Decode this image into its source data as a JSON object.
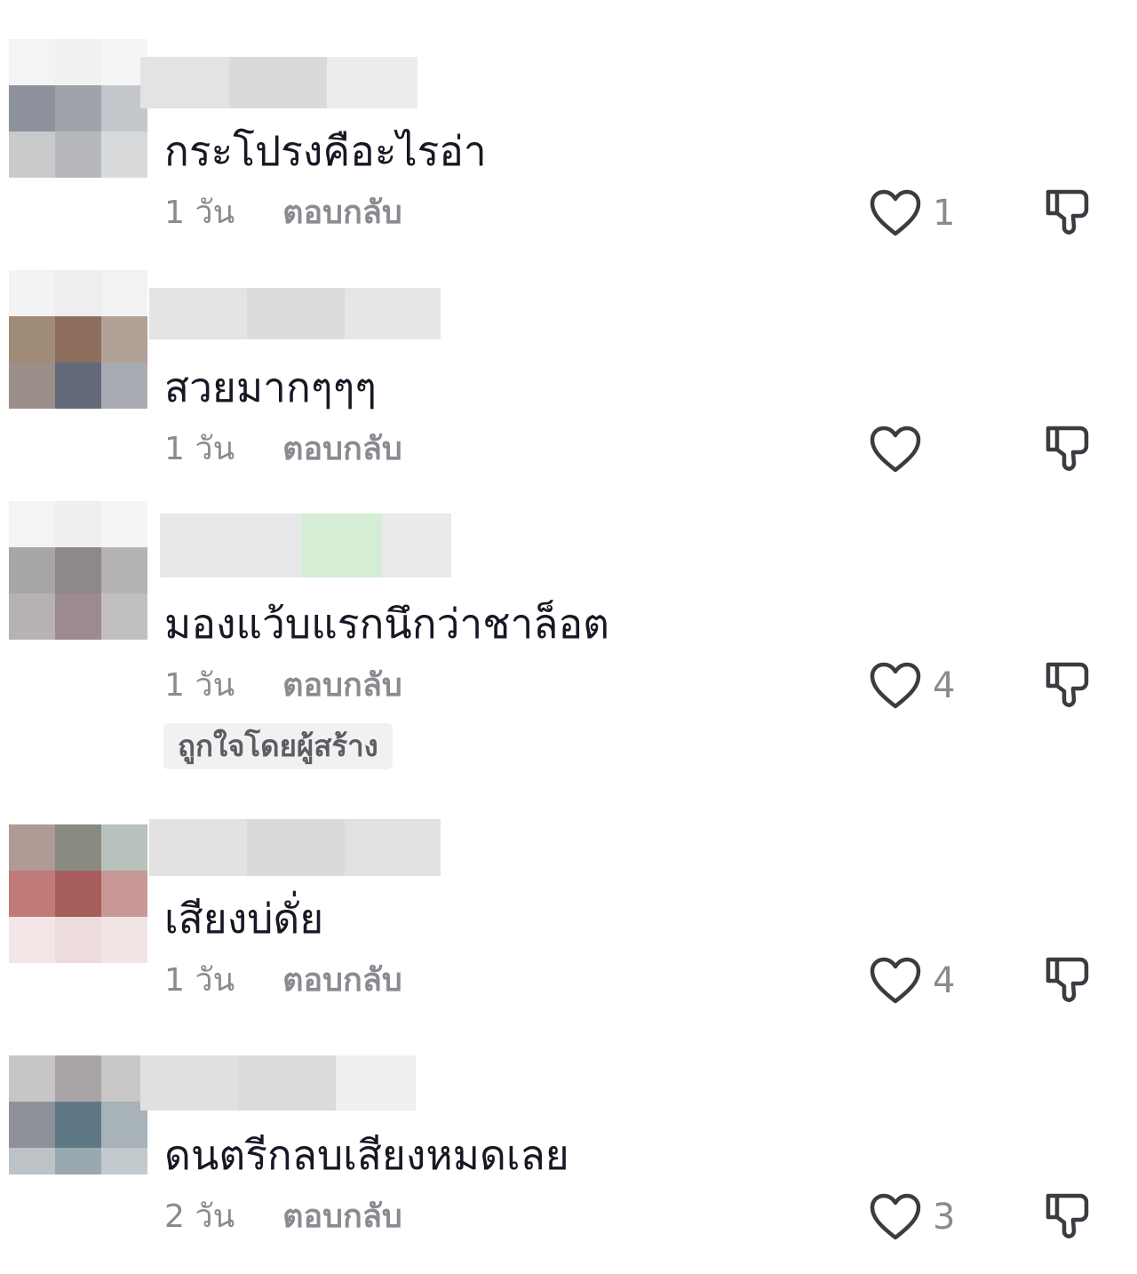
{
  "comments": [
    {
      "text": "กระโปรงคือะไรอ่า",
      "time": "1 วัน",
      "reply": "ตอบกลับ",
      "likes": "1",
      "creator_badge": ""
    },
    {
      "text": "สวยมากๆๆๆ",
      "time": "1 วัน",
      "reply": "ตอบกลับ",
      "likes": "",
      "creator_badge": ""
    },
    {
      "text": "มองแว้บแรกนึกว่าชาล็อต",
      "time": "1 วัน",
      "reply": "ตอบกลับ",
      "likes": "4",
      "creator_badge": "ถูกใจโดยผู้สร้าง"
    },
    {
      "text": "เสียงบ่ดั่ย",
      "time": "1 วัน",
      "reply": "ตอบกลับ",
      "likes": "4",
      "creator_badge": ""
    },
    {
      "text": "ดนตรีกลบเสียงหมดเลย",
      "time": "2 วัน",
      "reply": "ตอบกลับ",
      "likes": "3",
      "creator_badge": ""
    }
  ],
  "icons": {
    "like": "heart-outline-icon",
    "dislike": "thumbs-down-outline-icon"
  },
  "colors": {
    "text": "#161823",
    "meta": "#8a8b91",
    "icon": "#3b3c42",
    "badge_bg": "#f1f1f2"
  }
}
